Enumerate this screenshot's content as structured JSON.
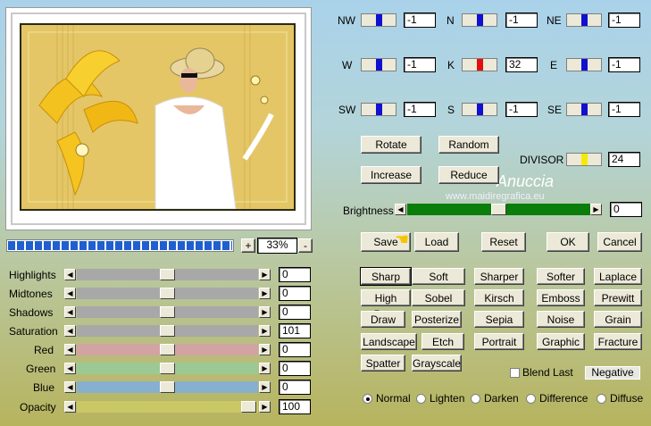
{
  "directions": [
    {
      "label": "NW",
      "value": "-1"
    },
    {
      "label": "N",
      "value": "-1"
    },
    {
      "label": "NE",
      "value": "-1"
    },
    {
      "label": "W",
      "value": "-1"
    },
    {
      "label": "K",
      "value": "32"
    },
    {
      "label": "E",
      "value": "-1"
    },
    {
      "label": "SW",
      "value": "-1"
    },
    {
      "label": "S",
      "value": "-1"
    },
    {
      "label": "SE",
      "value": "-1"
    }
  ],
  "buttons": {
    "rotate": "Rotate",
    "random": "Random",
    "increase": "Increase",
    "reduce": "Reduce",
    "save": "Save",
    "load": "Load",
    "reset": "Reset",
    "ok": "OK",
    "cancel": "Cancel"
  },
  "divisor": {
    "label": "DIVISOR",
    "value": "24"
  },
  "brightness": {
    "label": "Brightness",
    "value": "0"
  },
  "zoom": {
    "plus": "+",
    "value": "33%",
    "minus": "-"
  },
  "watermark": {
    "line1": "Anuccia",
    "line2": "www.maidiregrafica.eu"
  },
  "sliders": [
    {
      "label": "Highlights",
      "value": "0"
    },
    {
      "label": "Midtones",
      "value": "0"
    },
    {
      "label": "Shadows",
      "value": "0"
    },
    {
      "label": "Saturation",
      "value": "101"
    },
    {
      "label": "Red",
      "value": "0"
    },
    {
      "label": "Green",
      "value": "0"
    },
    {
      "label": "Blue",
      "value": "0"
    },
    {
      "label": "Opacity",
      "value": "100"
    }
  ],
  "presets": [
    [
      "Sharp",
      "Soft",
      "Sharper",
      "Softer",
      "Laplace"
    ],
    [
      "High Pass",
      "Sobel",
      "Kirsch",
      "Emboss",
      "Prewitt"
    ],
    [
      "Draw",
      "Posterize",
      "Sepia",
      "Noise",
      "Grain"
    ],
    [
      "Landscape",
      "Etch",
      "Portrait",
      "Graphic",
      "Fracture"
    ],
    [
      "Spatter",
      "Grayscale"
    ]
  ],
  "blend_last": "Blend Last",
  "negative": "Negative",
  "modes": [
    "Normal",
    "Lighten",
    "Darken",
    "Difference",
    "Diffuse"
  ],
  "colors": {
    "k_indicator": "#e01010",
    "dir_indicator": "#1010d0",
    "divisor_indicator": "#f5ea00",
    "brightness_track": "#0a7d0a",
    "red_track": "#d2a3a3",
    "green_track": "#9cc893",
    "blue_track": "#87afcf",
    "opacity_track": "#c9c766",
    "gray_track": "#a8a8a8",
    "progress": "#1f5fd0"
  }
}
